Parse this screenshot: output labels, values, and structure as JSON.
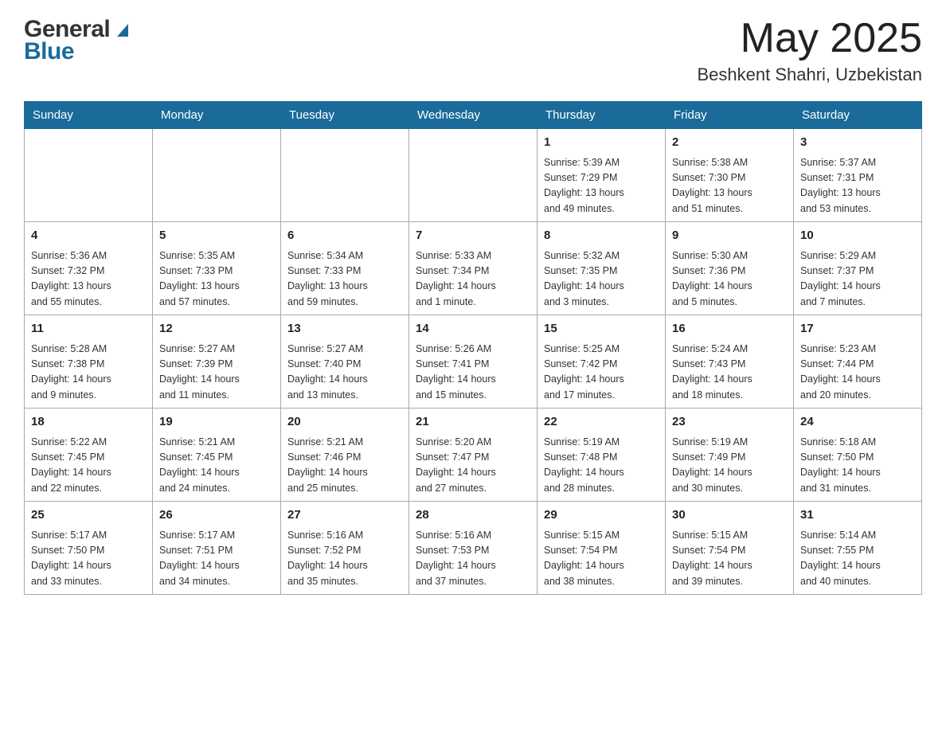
{
  "header": {
    "logo_general": "General",
    "logo_blue": "Blue",
    "month_year": "May 2025",
    "location": "Beshkent Shahri, Uzbekistan"
  },
  "calendar": {
    "days_of_week": [
      "Sunday",
      "Monday",
      "Tuesday",
      "Wednesday",
      "Thursday",
      "Friday",
      "Saturday"
    ],
    "weeks": [
      [
        {
          "day": "",
          "info": ""
        },
        {
          "day": "",
          "info": ""
        },
        {
          "day": "",
          "info": ""
        },
        {
          "day": "",
          "info": ""
        },
        {
          "day": "1",
          "info": "Sunrise: 5:39 AM\nSunset: 7:29 PM\nDaylight: 13 hours\nand 49 minutes."
        },
        {
          "day": "2",
          "info": "Sunrise: 5:38 AM\nSunset: 7:30 PM\nDaylight: 13 hours\nand 51 minutes."
        },
        {
          "day": "3",
          "info": "Sunrise: 5:37 AM\nSunset: 7:31 PM\nDaylight: 13 hours\nand 53 minutes."
        }
      ],
      [
        {
          "day": "4",
          "info": "Sunrise: 5:36 AM\nSunset: 7:32 PM\nDaylight: 13 hours\nand 55 minutes."
        },
        {
          "day": "5",
          "info": "Sunrise: 5:35 AM\nSunset: 7:33 PM\nDaylight: 13 hours\nand 57 minutes."
        },
        {
          "day": "6",
          "info": "Sunrise: 5:34 AM\nSunset: 7:33 PM\nDaylight: 13 hours\nand 59 minutes."
        },
        {
          "day": "7",
          "info": "Sunrise: 5:33 AM\nSunset: 7:34 PM\nDaylight: 14 hours\nand 1 minute."
        },
        {
          "day": "8",
          "info": "Sunrise: 5:32 AM\nSunset: 7:35 PM\nDaylight: 14 hours\nand 3 minutes."
        },
        {
          "day": "9",
          "info": "Sunrise: 5:30 AM\nSunset: 7:36 PM\nDaylight: 14 hours\nand 5 minutes."
        },
        {
          "day": "10",
          "info": "Sunrise: 5:29 AM\nSunset: 7:37 PM\nDaylight: 14 hours\nand 7 minutes."
        }
      ],
      [
        {
          "day": "11",
          "info": "Sunrise: 5:28 AM\nSunset: 7:38 PM\nDaylight: 14 hours\nand 9 minutes."
        },
        {
          "day": "12",
          "info": "Sunrise: 5:27 AM\nSunset: 7:39 PM\nDaylight: 14 hours\nand 11 minutes."
        },
        {
          "day": "13",
          "info": "Sunrise: 5:27 AM\nSunset: 7:40 PM\nDaylight: 14 hours\nand 13 minutes."
        },
        {
          "day": "14",
          "info": "Sunrise: 5:26 AM\nSunset: 7:41 PM\nDaylight: 14 hours\nand 15 minutes."
        },
        {
          "day": "15",
          "info": "Sunrise: 5:25 AM\nSunset: 7:42 PM\nDaylight: 14 hours\nand 17 minutes."
        },
        {
          "day": "16",
          "info": "Sunrise: 5:24 AM\nSunset: 7:43 PM\nDaylight: 14 hours\nand 18 minutes."
        },
        {
          "day": "17",
          "info": "Sunrise: 5:23 AM\nSunset: 7:44 PM\nDaylight: 14 hours\nand 20 minutes."
        }
      ],
      [
        {
          "day": "18",
          "info": "Sunrise: 5:22 AM\nSunset: 7:45 PM\nDaylight: 14 hours\nand 22 minutes."
        },
        {
          "day": "19",
          "info": "Sunrise: 5:21 AM\nSunset: 7:45 PM\nDaylight: 14 hours\nand 24 minutes."
        },
        {
          "day": "20",
          "info": "Sunrise: 5:21 AM\nSunset: 7:46 PM\nDaylight: 14 hours\nand 25 minutes."
        },
        {
          "day": "21",
          "info": "Sunrise: 5:20 AM\nSunset: 7:47 PM\nDaylight: 14 hours\nand 27 minutes."
        },
        {
          "day": "22",
          "info": "Sunrise: 5:19 AM\nSunset: 7:48 PM\nDaylight: 14 hours\nand 28 minutes."
        },
        {
          "day": "23",
          "info": "Sunrise: 5:19 AM\nSunset: 7:49 PM\nDaylight: 14 hours\nand 30 minutes."
        },
        {
          "day": "24",
          "info": "Sunrise: 5:18 AM\nSunset: 7:50 PM\nDaylight: 14 hours\nand 31 minutes."
        }
      ],
      [
        {
          "day": "25",
          "info": "Sunrise: 5:17 AM\nSunset: 7:50 PM\nDaylight: 14 hours\nand 33 minutes."
        },
        {
          "day": "26",
          "info": "Sunrise: 5:17 AM\nSunset: 7:51 PM\nDaylight: 14 hours\nand 34 minutes."
        },
        {
          "day": "27",
          "info": "Sunrise: 5:16 AM\nSunset: 7:52 PM\nDaylight: 14 hours\nand 35 minutes."
        },
        {
          "day": "28",
          "info": "Sunrise: 5:16 AM\nSunset: 7:53 PM\nDaylight: 14 hours\nand 37 minutes."
        },
        {
          "day": "29",
          "info": "Sunrise: 5:15 AM\nSunset: 7:54 PM\nDaylight: 14 hours\nand 38 minutes."
        },
        {
          "day": "30",
          "info": "Sunrise: 5:15 AM\nSunset: 7:54 PM\nDaylight: 14 hours\nand 39 minutes."
        },
        {
          "day": "31",
          "info": "Sunrise: 5:14 AM\nSunset: 7:55 PM\nDaylight: 14 hours\nand 40 minutes."
        }
      ]
    ]
  }
}
